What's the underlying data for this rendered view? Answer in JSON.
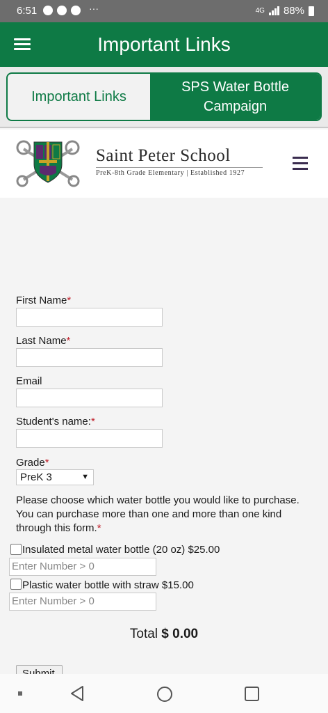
{
  "status_bar": {
    "time": "6:51",
    "icons": [
      "facebook-icon",
      "settings-icon",
      "alert-icon"
    ],
    "overflow": "···",
    "network": "4G",
    "battery": "88%"
  },
  "app_bar": {
    "title": "Important Links",
    "menu_icon": "hamburger-menu-icon"
  },
  "tabs": [
    {
      "label": "Important Links",
      "active": false
    },
    {
      "label": "SPS Water Bottle Campaign",
      "active": true
    }
  ],
  "school": {
    "name": "Saint Peter School",
    "tagline": "PreK-8th Grade Elementary | Established 1927",
    "crest_icon": "school-crest-icon",
    "menu_icon": "hamburger-menu-icon"
  },
  "form": {
    "first_name_label": "First Name",
    "last_name_label": "Last Name",
    "email_label": "Email",
    "student_name_label": "Student's name:",
    "grade_label": "Grade",
    "grade_selected": "PreK 3",
    "required_mark": "*",
    "instructions": "Please choose which water bottle you would like to purchase. You can purchase more than one and more than one kind through this form.",
    "options": [
      {
        "label": "Insulated metal water bottle (20 oz) $25.00",
        "quantity_placeholder": "Enter Number > 0"
      },
      {
        "label": "Plastic water bottle with straw $15.00",
        "quantity_placeholder": "Enter Number > 0"
      }
    ],
    "total_label": "Total",
    "total_value": "$ 0.00",
    "submit_label": "Submit"
  },
  "colors": {
    "brand_green": "#0e7a45",
    "required_red": "#c0202b",
    "crest_purple": "#5b2a6e",
    "crest_gold": "#c9a227"
  }
}
